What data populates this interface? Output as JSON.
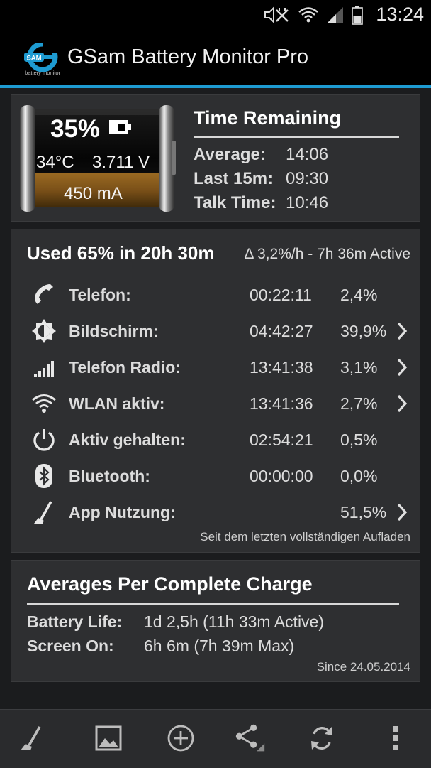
{
  "status_bar": {
    "time": "13:24"
  },
  "app": {
    "title": "GSam Battery Monitor Pro",
    "logo_text": "SAM",
    "logo_sub": "battery monitor",
    "accent": "#1e9bd2"
  },
  "battery": {
    "percent": "35%",
    "temperature": "34°C",
    "voltage": "3.711 V",
    "current": "450 mA",
    "level": 0.35
  },
  "time_remaining": {
    "title": "Time Remaining",
    "rows": [
      {
        "label": "Average:",
        "value": "14:06"
      },
      {
        "label": "Last 15m:",
        "value": "09:30"
      },
      {
        "label": "Talk Time:",
        "value": "10:46"
      }
    ]
  },
  "usage": {
    "headline": "Used 65% in 20h 30m",
    "rate": "Δ 3,2%/h - 7h 36m Active",
    "rows": [
      {
        "icon": "phone-icon",
        "label": "Telefon:",
        "time": "00:22:11",
        "pct": "2,4%",
        "chevron": false
      },
      {
        "icon": "brightness-icon",
        "label": "Bildschirm:",
        "time": "04:42:27",
        "pct": "39,9%",
        "chevron": true
      },
      {
        "icon": "signal-bars-icon",
        "label": "Telefon Radio:",
        "time": "13:41:38",
        "pct": "3,1%",
        "chevron": true
      },
      {
        "icon": "wifi-icon",
        "label": "WLAN aktiv:",
        "time": "13:41:36",
        "pct": "2,7%",
        "chevron": true
      },
      {
        "icon": "power-icon",
        "label": "Aktiv gehalten:",
        "time": "02:54:21",
        "pct": "0,5%",
        "chevron": false
      },
      {
        "icon": "bluetooth-icon",
        "label": "Bluetooth:",
        "time": "00:00:00",
        "pct": "0,0%",
        "chevron": false
      },
      {
        "icon": "app-usage-icon",
        "label": "App Nutzung:",
        "time": "",
        "pct": "51,5%",
        "chevron": true
      }
    ],
    "footer": "Seit dem letzten vollständigen Aufladen"
  },
  "averages": {
    "title": "Averages Per Complete Charge",
    "rows": [
      {
        "label": "Battery Life:",
        "value": "1d 2,5h (11h 33m Active)"
      },
      {
        "label": "Screen On:",
        "value": "6h 6m (7h 39m Max)"
      }
    ],
    "since": "Since 24.05.2014"
  },
  "bottom_bar": [
    "app-usage-icon",
    "image-icon",
    "add-circle-icon",
    "share-icon",
    "refresh-icon",
    "overflow-menu-icon"
  ]
}
